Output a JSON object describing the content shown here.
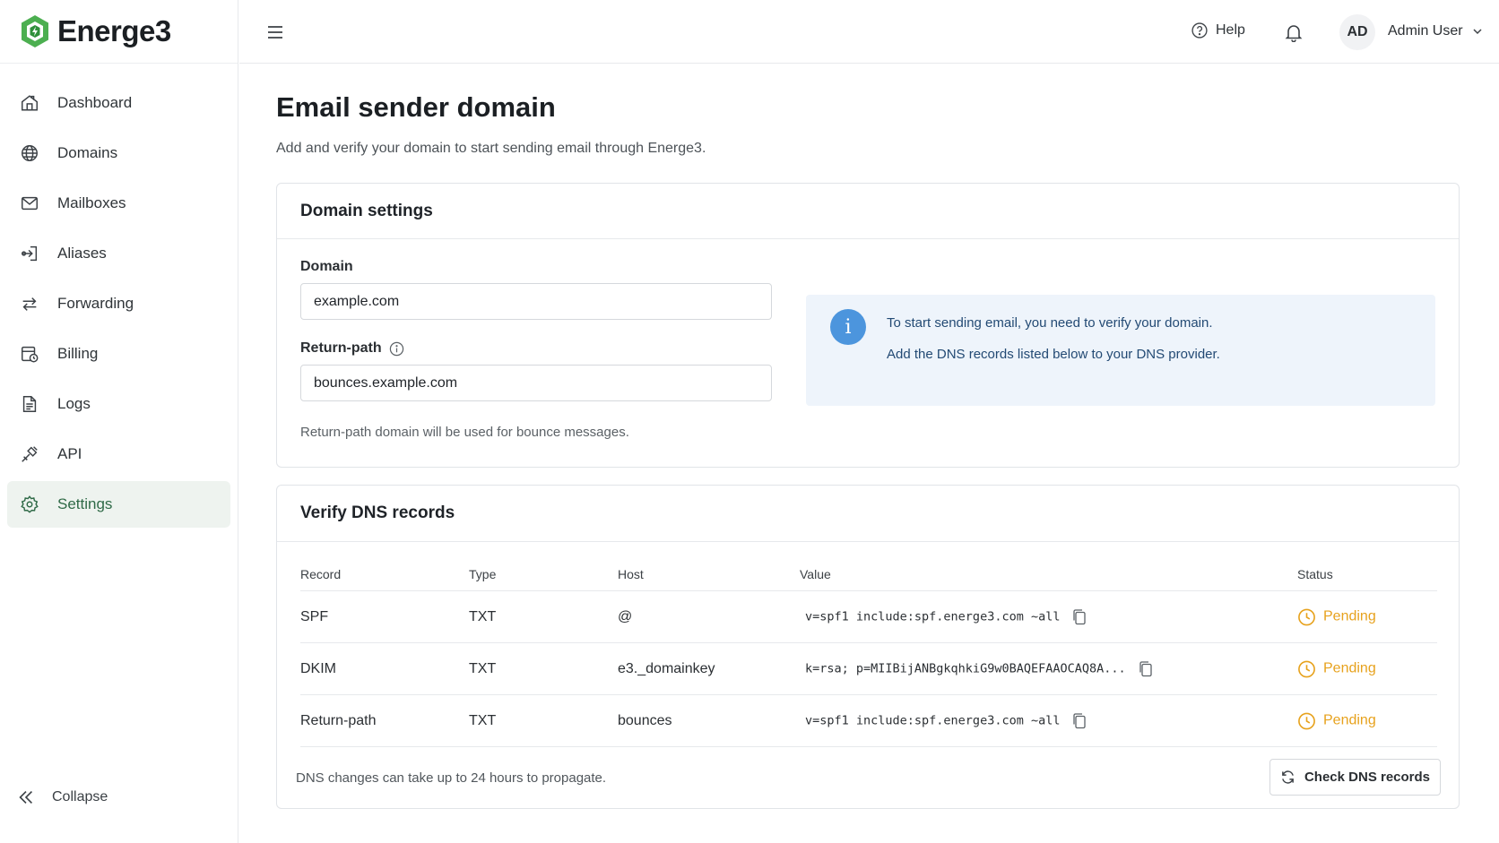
{
  "brand": {
    "name": "Energe3",
    "accent": "#4caf50"
  },
  "sidebar": {
    "items": [
      {
        "label": "Dashboard",
        "icon": "home-icon"
      },
      {
        "label": "Domains",
        "icon": "globe-icon"
      },
      {
        "label": "Mailboxes",
        "icon": "mail-icon"
      },
      {
        "label": "Aliases",
        "icon": "alias-icon"
      },
      {
        "label": "Forwarding",
        "icon": "forward-arrows-icon"
      },
      {
        "label": "Billing",
        "icon": "billing-icon"
      },
      {
        "label": "Logs",
        "icon": "document-icon"
      },
      {
        "label": "API",
        "icon": "api-plug-icon"
      },
      {
        "label": "Settings",
        "icon": "gear-icon",
        "active": true
      }
    ],
    "collapse_label": "Collapse"
  },
  "topbar": {
    "help_label": "Help",
    "avatar_initials": "AD",
    "user_name": "Admin User"
  },
  "page": {
    "title": "Email sender domain",
    "subtitle": "Add and verify your domain to start sending email through Energe3."
  },
  "domain_settings": {
    "title": "Domain settings",
    "domain_label": "Domain",
    "domain_value": "example.com",
    "return_path_label": "Return-path",
    "return_path_value": "bounces.example.com",
    "return_path_hint": "Return-path domain will be used for bounce messages.",
    "info_line1": "To start sending email, you need to verify your domain.",
    "info_line2": "Add the DNS records listed below to your DNS provider.",
    "info_color": "#4c95dd"
  },
  "dns": {
    "title": "Verify DNS records",
    "columns": {
      "record": "Record",
      "type": "Type",
      "host": "Host",
      "value": "Value",
      "status": "Status"
    },
    "rows": [
      {
        "record": "SPF",
        "type": "TXT",
        "host": "@",
        "value": "v=spf1 include:spf.energe3.com ~all",
        "status": "Pending"
      },
      {
        "record": "DKIM",
        "type": "TXT",
        "host": "e3._domainkey",
        "value": "k=rsa; p=MIIBijANBgkqhkiG9w0BAQEFAAOCAQ8A...",
        "status": "Pending"
      },
      {
        "record": "Return-path",
        "type": "TXT",
        "host": "bounces",
        "value": "v=spf1 include:spf.energe3.com ~all",
        "status": "Pending"
      }
    ],
    "pending_color": "#e7a21d",
    "note": "DNS changes can take up to 24 hours to propagate.",
    "check_button_label": "Check DNS records"
  }
}
